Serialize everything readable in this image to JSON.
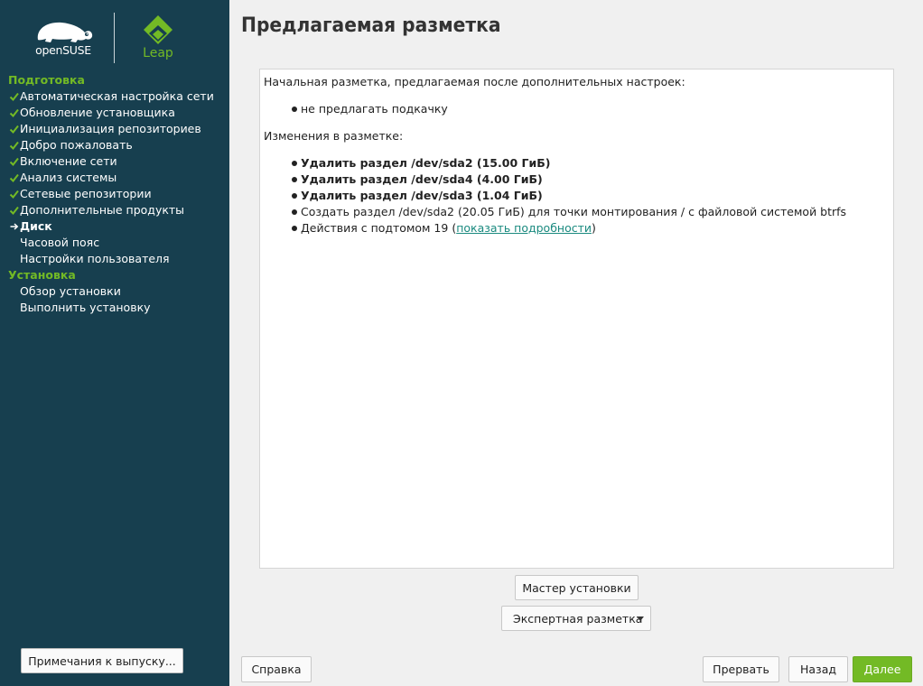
{
  "sidebar": {
    "logo_opensuse": "openSUSE",
    "logo_leap": "Leap",
    "sections": [
      {
        "title": "Подготовка",
        "steps": [
          {
            "label": "Автоматическая настройка сети",
            "state": "done"
          },
          {
            "label": "Обновление установщика",
            "state": "done"
          },
          {
            "label": "Инициализация репозиториев",
            "state": "done"
          },
          {
            "label": "Добро пожаловать",
            "state": "done"
          },
          {
            "label": "Включение сети",
            "state": "done"
          },
          {
            "label": "Анализ системы",
            "state": "done"
          },
          {
            "label": "Сетевые репозитории",
            "state": "done"
          },
          {
            "label": "Дополнительные продукты",
            "state": "done"
          },
          {
            "label": "Диск",
            "state": "current"
          },
          {
            "label": "Часовой пояс",
            "state": "pending"
          },
          {
            "label": "Настройки пользователя",
            "state": "pending"
          }
        ]
      },
      {
        "title": "Установка",
        "steps": [
          {
            "label": "Обзор установки",
            "state": "pending"
          },
          {
            "label": "Выполнить установку",
            "state": "pending"
          }
        ]
      }
    ],
    "release_notes_label": "Примечания к выпуску..."
  },
  "page": {
    "title": "Предлагаемая разметка"
  },
  "proposal": {
    "initial_heading": "Начальная разметка, предлагаемая после дополнительных настроек:",
    "initial_items": [
      "не предлагать подкачку"
    ],
    "changes_heading": "Изменения в разметке:",
    "changes": [
      {
        "text": "Удалить раздел /dev/sda2 (15.00 ГиБ)",
        "bold": true
      },
      {
        "text": "Удалить раздел /dev/sda4 (4.00 ГиБ)",
        "bold": true
      },
      {
        "text": "Удалить раздел /dev/sda3 (1.04 ГиБ)",
        "bold": true
      },
      {
        "text": "Создать раздел /dev/sda2 (20.05 ГиБ) для точки монтирования / с файловой системой btrfs",
        "bold": false
      }
    ],
    "subvolume_prefix": "Действия с подтомом 19 (",
    "subvolume_link": "показать подробности",
    "subvolume_suffix": ")"
  },
  "buttons": {
    "installer_wizard": "Мастер установки",
    "expert_partitioner": "Экспертная разметка",
    "help": "Справка",
    "abort": "Прервать",
    "back": "Назад",
    "next": "Далее"
  },
  "colors": {
    "sidebar_bg": "#173f4f",
    "accent_green": "#73ba25",
    "link_teal": "#1a8a7f"
  },
  "icons": {
    "done_step": "checkmark-icon",
    "current_step": "arrow-right-icon",
    "expert_menu": "chevron-down-icon"
  }
}
